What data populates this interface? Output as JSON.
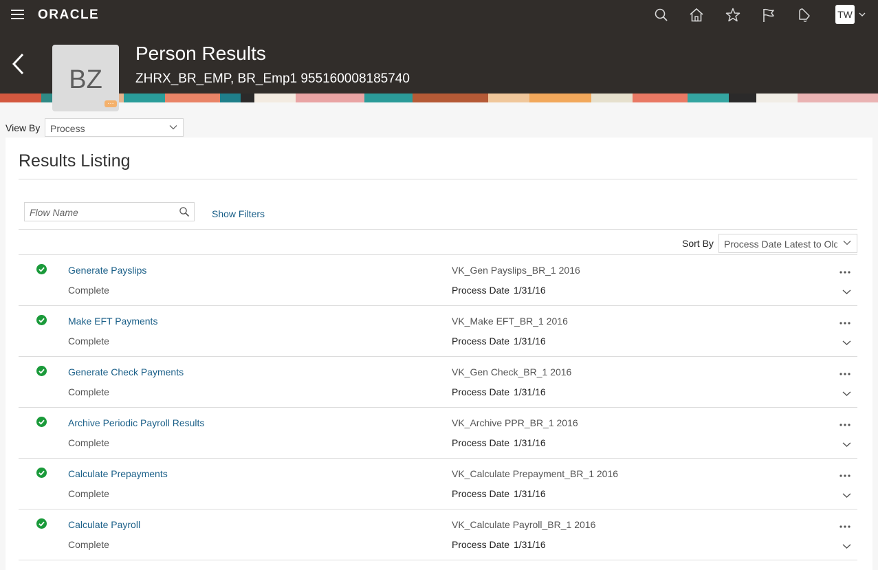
{
  "brand": "ORACLE",
  "user": {
    "initials": "TW"
  },
  "header": {
    "title": "Person Results",
    "subtitle": "ZHRX_BR_EMP, BR_Emp1 955160008185740",
    "avatar_initials": "BZ",
    "avatar_more": "…"
  },
  "view_by": {
    "label": "View By",
    "value": "Process"
  },
  "section": {
    "title": "Results Listing"
  },
  "search": {
    "placeholder": "Flow Name",
    "value": ""
  },
  "show_filters": "Show Filters",
  "sort_by": {
    "label": "Sort By",
    "value": "Process Date Latest to Oldest"
  },
  "process_date_label": "Process Date",
  "results": [
    {
      "flow_name": "Generate Payslips",
      "status": "Complete",
      "flow_instance": "VK_Gen Payslips_BR_1 2016",
      "process_date": "1/31/16"
    },
    {
      "flow_name": "Make EFT Payments",
      "status": "Complete",
      "flow_instance": "VK_Make EFT_BR_1 2016",
      "process_date": "1/31/16"
    },
    {
      "flow_name": "Generate Check Payments",
      "status": "Complete",
      "flow_instance": "VK_Gen Check_BR_1 2016",
      "process_date": "1/31/16"
    },
    {
      "flow_name": "Archive Periodic Payroll Results",
      "status": "Complete",
      "flow_instance": "VK_Archive PPR_BR_1 2016",
      "process_date": "1/31/16"
    },
    {
      "flow_name": "Calculate Prepayments",
      "status": "Complete",
      "flow_instance": "VK_Calculate Prepayment_BR_1 2016",
      "process_date": "1/31/16"
    },
    {
      "flow_name": "Calculate Payroll",
      "status": "Complete",
      "flow_instance": "VK_Calculate Payroll_BR_1 2016",
      "process_date": "1/31/16"
    }
  ],
  "icons": {
    "nav": [
      "search-icon",
      "home-icon",
      "favorites-star-icon",
      "watchlist-flag-icon",
      "notifications-bell-icon"
    ],
    "status": "complete-check-icon"
  },
  "colors": {
    "header_bg": "#312d2a",
    "link": "#1a5f88",
    "success": "#1a9a3a",
    "avatar_badge": "#f4b16c"
  }
}
